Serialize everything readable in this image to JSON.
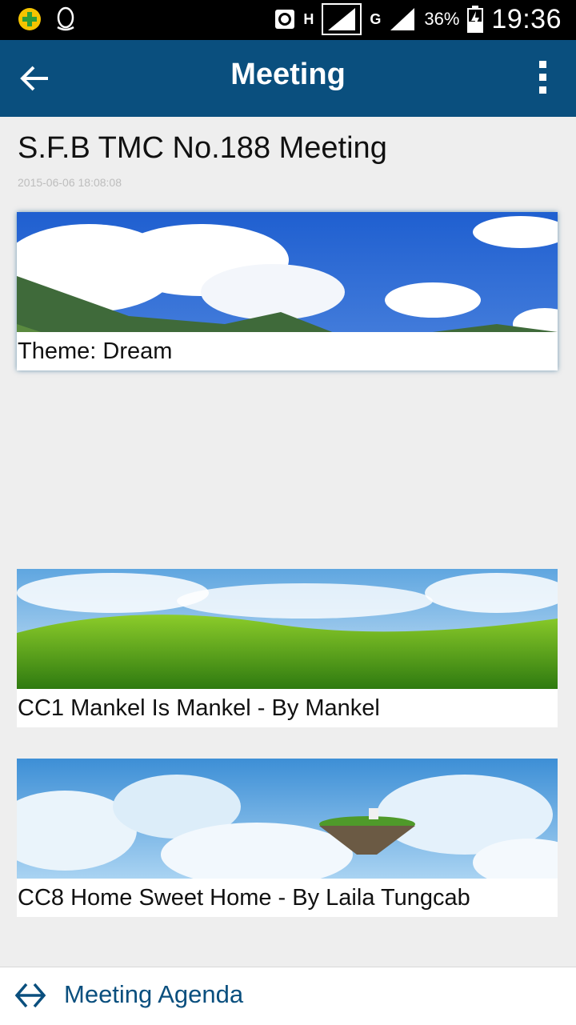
{
  "status_bar": {
    "network_h": "H",
    "network_g": "G",
    "battery": "36%",
    "time": "19:36"
  },
  "app_bar": {
    "title": "Meeting",
    "back_icon": "arrow-left-icon",
    "menu_icon": "overflow-menu-icon"
  },
  "meeting": {
    "title": "S.F.B TMC No.188 Meeting",
    "date": "2015-06-06 18:08:08"
  },
  "items": [
    {
      "caption": "Theme: Dream",
      "image": "tents-on-grassland-photo"
    },
    {
      "caption": "CC1 Mankel Is Mankel - By Mankel",
      "image": "green-hills-photo"
    },
    {
      "caption": "CC8 Home Sweet Home - By Laila Tungcab",
      "image": "floating-island-clouds-photo"
    }
  ],
  "bottom_bar": {
    "label": "Meeting Agenda",
    "icon": "double-arrow-icon"
  },
  "colors": {
    "app_bar": "#0a4f7e",
    "accent": "#0a4f7e",
    "background": "#eeeeee"
  }
}
